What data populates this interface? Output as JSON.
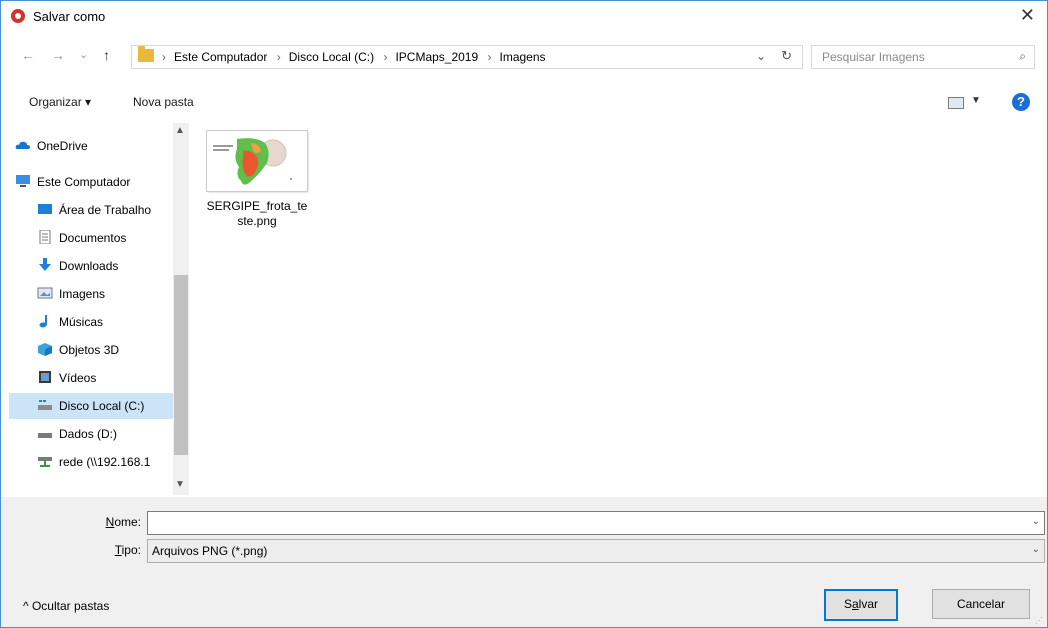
{
  "window": {
    "title": "Salvar como",
    "close_glyph": "✕"
  },
  "nav": {
    "back": "←",
    "forward": "→",
    "recent": "⌄",
    "up": "↑"
  },
  "address": {
    "crumbs": [
      "Este Computador",
      "Disco Local (C:)",
      "IPCMaps_2019",
      "Imagens"
    ],
    "separator": "›",
    "dropdown": "⌄",
    "refresh": "↻"
  },
  "search": {
    "placeholder": "Pesquisar Imagens",
    "icon": "⌕"
  },
  "toolbar": {
    "organize": "Organizar ▾",
    "new_folder": "Nova pasta",
    "help": "?"
  },
  "sidebar": {
    "items": [
      {
        "label": "OneDrive",
        "icon": "cloud-icon"
      },
      {
        "label": "Este Computador",
        "icon": "computer-icon"
      },
      {
        "label": "Área de Trabalho",
        "icon": "desktop-icon"
      },
      {
        "label": "Documentos",
        "icon": "documents-icon"
      },
      {
        "label": "Downloads",
        "icon": "downloads-icon"
      },
      {
        "label": "Imagens",
        "icon": "pictures-icon"
      },
      {
        "label": "Músicas",
        "icon": "music-icon"
      },
      {
        "label": "Objetos 3D",
        "icon": "objects-3d-icon"
      },
      {
        "label": "Vídeos",
        "icon": "videos-icon"
      },
      {
        "label": "Disco Local (C:)",
        "icon": "drive-icon",
        "selected": true
      },
      {
        "label": "Dados (D:)",
        "icon": "drive-icon"
      },
      {
        "label": "rede (\\\\192.168.1",
        "icon": "network-drive-icon"
      }
    ],
    "scroll_up": "▲",
    "scroll_down": "▼"
  },
  "files": [
    {
      "name_line1": "SERGIPE_frota_te",
      "name_line2": "ste.png",
      "icon": "image-thumbnail"
    }
  ],
  "form": {
    "name_label_u": "N",
    "name_label_rest": "ome:",
    "name_value": "",
    "type_label_u": "T",
    "type_label_rest": "ipo:",
    "type_value": "Arquivos PNG (*.png)",
    "dropdown": "⌄"
  },
  "footer": {
    "hide_folders": "^  Ocultar pastas",
    "save_u": "a",
    "save_pre": "S",
    "save_post": "lvar",
    "cancel": "Cancelar"
  }
}
